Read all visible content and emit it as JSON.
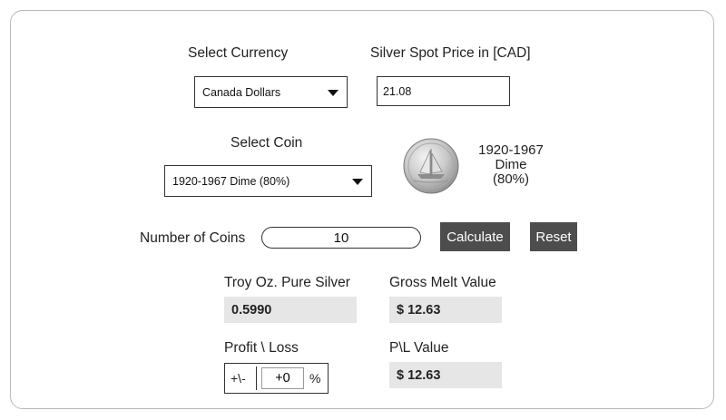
{
  "currency": {
    "label": "Select Currency",
    "selected": "Canada Dollars"
  },
  "spot_price": {
    "label": "Silver Spot Price in [CAD]",
    "value": "21.08"
  },
  "coin": {
    "label": "Select Coin",
    "selected": "1920-1967 Dime (80%)",
    "caption_line1": "1920-1967",
    "caption_line2": "Dime",
    "caption_line3": "(80%)"
  },
  "quantity": {
    "label": "Number of Coins",
    "value": "10"
  },
  "buttons": {
    "calculate": "Calculate",
    "reset": "Reset"
  },
  "results": {
    "troy_label": "Troy Oz. Pure Silver",
    "troy_value": "0.5990",
    "gross_label": "Gross Melt Value",
    "gross_value": "$ 12.63",
    "profit_label": "Profit \\ Loss",
    "profit_prefix": "+\\-",
    "profit_value": "+0",
    "profit_suffix": "%",
    "pl_label": "P\\L Value",
    "pl_value": "$ 12.63"
  },
  "colors": {
    "button_bg": "#4d4d4d",
    "result_bg": "#e6e6e6",
    "panel_border": "#b9b9b9"
  }
}
